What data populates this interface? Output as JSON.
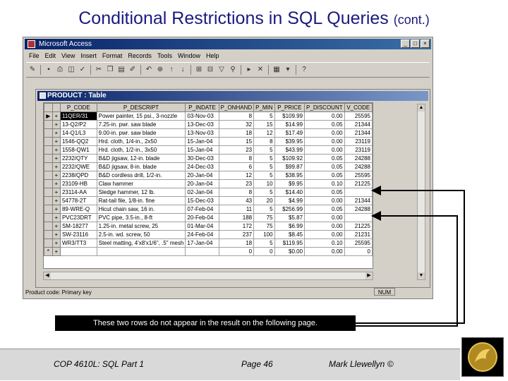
{
  "slide": {
    "title": "Conditional Restrictions in SQL Queries",
    "title_suffix": "(cont.)",
    "callout": "These two rows do not appear in the result on the following page.",
    "footer_left": "COP 4610L: SQL Part 1",
    "footer_mid": "Page 46",
    "footer_right": "Mark Llewellyn ©"
  },
  "app": {
    "title": "Microsoft Access",
    "menu": [
      "File",
      "Edit",
      "View",
      "Insert",
      "Format",
      "Records",
      "Tools",
      "Window",
      "Help"
    ],
    "status_text": "Product code: Primary key",
    "status_num": "NUM"
  },
  "table_window": {
    "title": "PRODUCT : Table",
    "columns": [
      "P_CODE",
      "P_DESCRIPT",
      "P_INDATE",
      "P_ONHAND",
      "P_MIN",
      "P_PRICE",
      "P_DISCOUNT",
      "V_CODE"
    ],
    "rows": [
      [
        "11QER/31",
        "Power painter, 15 psi., 3-nozzle",
        "03-Nov-03",
        "8",
        "5",
        "$109.99",
        "0.00",
        "25595"
      ],
      [
        "13-Q2/P2",
        "7.25-in. pwr. saw blade",
        "13-Dec-03",
        "32",
        "15",
        "$14.99",
        "0.05",
        "21344"
      ],
      [
        "14-Q1/L3",
        "9.00-in. pwr. saw blade",
        "13-Nov-03",
        "18",
        "12",
        "$17.49",
        "0.00",
        "21344"
      ],
      [
        "1546-QQ2",
        "Hrd. cloth, 1/4-in., 2x50",
        "15-Jan-04",
        "15",
        "8",
        "$39.95",
        "0.00",
        "23119"
      ],
      [
        "1558-QW1",
        "Hrd. cloth, 1/2-in., 3x50",
        "15-Jan-04",
        "23",
        "5",
        "$43.99",
        "0.00",
        "23119"
      ],
      [
        "2232/QTY",
        "B&D jigsaw, 12-in. blade",
        "30-Dec-03",
        "8",
        "5",
        "$109.92",
        "0.05",
        "24288"
      ],
      [
        "2232/QWE",
        "B&D jigsaw, 8-in. blade",
        "24-Dec-03",
        "6",
        "5",
        "$99.87",
        "0.05",
        "24288"
      ],
      [
        "2238/QPD",
        "B&D cordless drill, 1/2-in.",
        "20-Jan-04",
        "12",
        "5",
        "$38.95",
        "0.05",
        "25595"
      ],
      [
        "23109-HB",
        "Claw hammer",
        "20-Jan-04",
        "23",
        "10",
        "$9.95",
        "0.10",
        "21225"
      ],
      [
        "23114-AA",
        "Sledge hammer, 12 lb.",
        "02-Jan-04",
        "8",
        "5",
        "$14.40",
        "0.05",
        ""
      ],
      [
        "54778-2T",
        "Rat-tail file, 1/8-in. fine",
        "15-Dec-03",
        "43",
        "20",
        "$4.99",
        "0.00",
        "21344"
      ],
      [
        "89-WRE-Q",
        "Hicut chain saw, 16 in.",
        "07-Feb-04",
        "11",
        "5",
        "$256.99",
        "0.05",
        "24288"
      ],
      [
        "PVC23DRT",
        "PVC pipe, 3.5-in., 8-ft",
        "20-Feb-04",
        "188",
        "75",
        "$5.87",
        "0.00",
        ""
      ],
      [
        "SM-18277",
        "1.25-in. metal screw, 25",
        "01-Mar-04",
        "172",
        "75",
        "$6.99",
        "0.00",
        "21225"
      ],
      [
        "SW-23116",
        "2.5-in. wd. screw, 50",
        "24-Feb-04",
        "237",
        "100",
        "$8.45",
        "0.00",
        "21231"
      ],
      [
        "WR3/TT3",
        "Steel matting, 4'x8'x1/6\", .5\" mesh",
        "17-Jan-04",
        "18",
        "5",
        "$119.95",
        "0.10",
        "25595"
      ]
    ],
    "new_row": [
      "",
      "",
      "",
      "0",
      "0",
      "$0.00",
      "0.00",
      "0"
    ]
  },
  "colors": {
    "title": "#1a1a80",
    "titlebar": "#0a246a",
    "chrome": "#d4d0c8",
    "footer": "#d9d9d9",
    "callout_bg": "#000000"
  }
}
